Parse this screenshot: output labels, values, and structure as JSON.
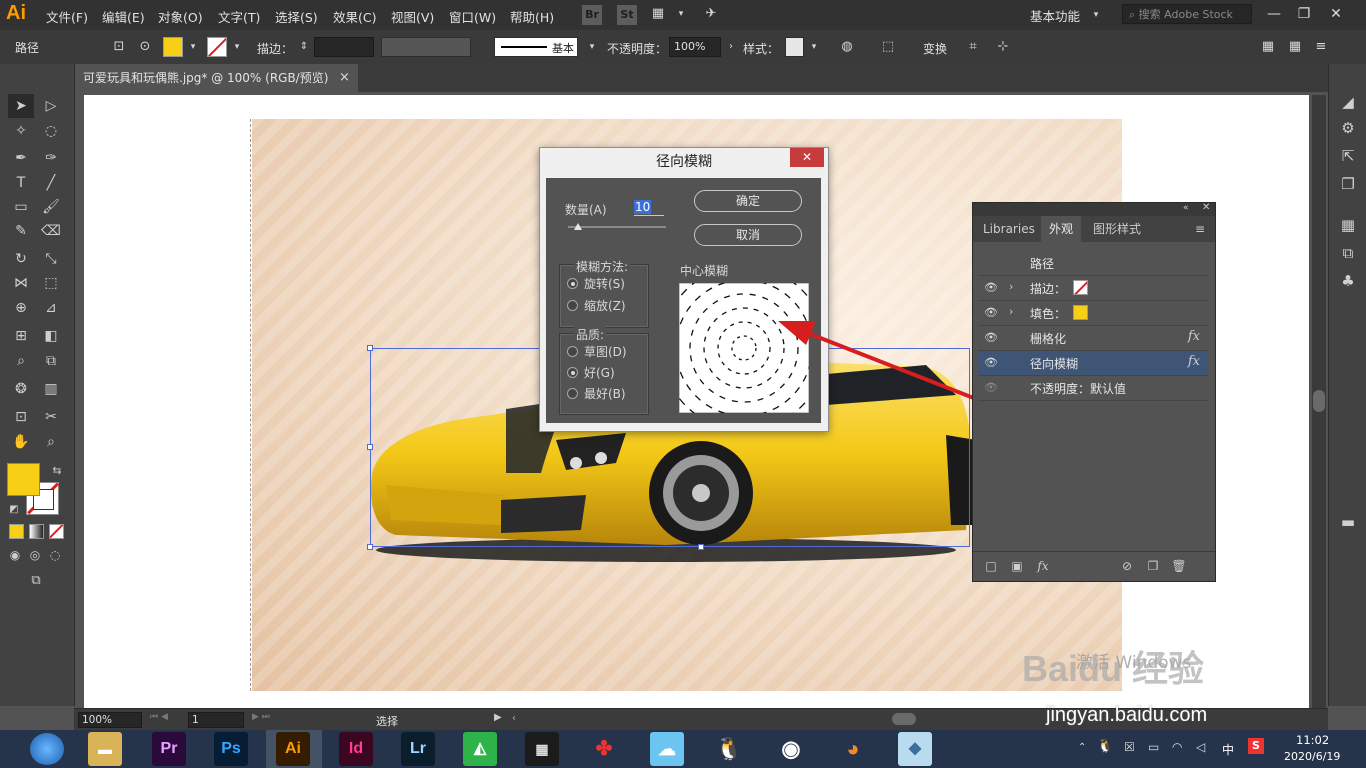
{
  "app": {
    "logo": "Ai"
  },
  "menubar": {
    "items": [
      "文件(F)",
      "编辑(E)",
      "对象(O)",
      "文字(T)",
      "选择(S)",
      "效果(C)",
      "视图(V)",
      "窗口(W)",
      "帮助(H)"
    ],
    "bridge": "Br",
    "stock": "St",
    "workspace": "基本功能",
    "search_placeholder": "搜索 Adobe Stock"
  },
  "control": {
    "selection": "路径",
    "stroke_label": "描边：",
    "stroke_style": "基本",
    "opacity_label": "不透明度：",
    "opacity_value": "100%",
    "style_label": "样式：",
    "transform": "变换"
  },
  "document": {
    "tab_title": "可爱玩具和玩偶熊.jpg* @ 100% (RGB/预览)",
    "close": "×"
  },
  "colors": {
    "fill": "#f7cf17",
    "accent": "#3e5576",
    "close_red": "#c63c3c"
  },
  "status": {
    "zoom": "100%",
    "page": "1",
    "tool": "选择"
  },
  "dialog": {
    "title": "径向模糊",
    "close": "✕",
    "amount_label": "数量(A)",
    "amount_value": "10",
    "amount_fraction": 0.1,
    "ok": "确定",
    "cancel": "取消",
    "method_label": "模糊方法:",
    "method_spin": "旋转(S)",
    "method_zoom": "缩放(Z)",
    "quality_label": "品质:",
    "quality_draft": "草图(D)",
    "quality_good": "好(G)",
    "quality_best": "最好(B)",
    "center_label": "中心模糊"
  },
  "appearance": {
    "tabs": [
      "Libraries",
      "外观",
      "图形样式"
    ],
    "title": "路径",
    "rows": [
      {
        "label": "描边：",
        "swatch": "stroke-none"
      },
      {
        "label": "填色：",
        "swatch": "#f7cf17"
      },
      {
        "label": "栅格化",
        "fx": "fx"
      },
      {
        "label": "径向模糊",
        "fx": "fx"
      },
      {
        "label": "不透明度：默认值"
      }
    ]
  },
  "watermark": {
    "activate": "激活 Windows",
    "baidu": "Baidu 经验",
    "url": "jingyan.baidu.com"
  },
  "taskbar": {
    "apps": [
      "Pr",
      "Ps",
      "Ai",
      "Id",
      "Lr"
    ],
    "time": "11:02",
    "date": "2020/6/19",
    "ime": "中"
  }
}
